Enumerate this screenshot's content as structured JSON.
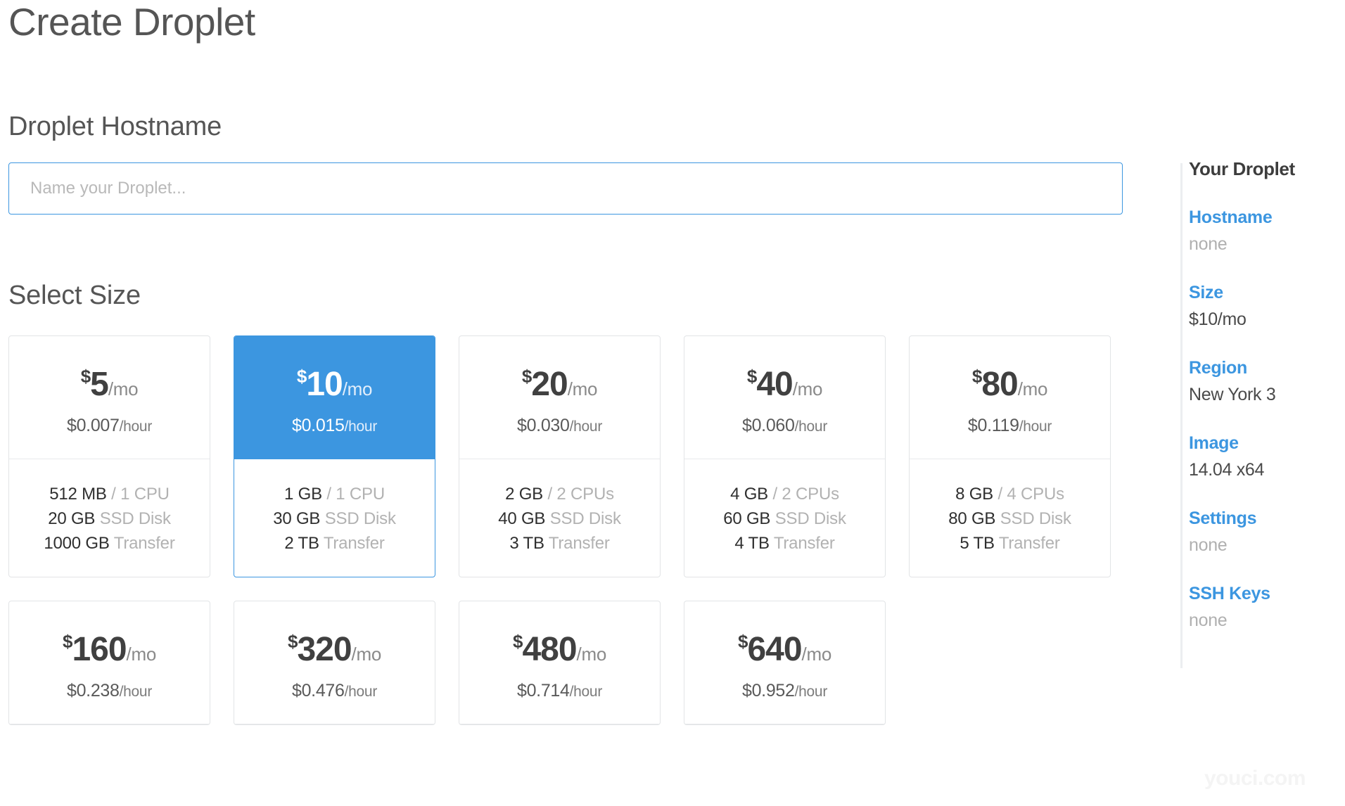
{
  "page": {
    "title": "Create Droplet",
    "watermark": "youci.com"
  },
  "hostname_section": {
    "heading": "Droplet Hostname",
    "placeholder": "Name your Droplet...",
    "value": ""
  },
  "size_section": {
    "heading": "Select Size",
    "cards": [
      {
        "currency": "$",
        "amount": "5",
        "period": "/mo",
        "hourly_price": "$0.007",
        "hourly_unit": "/hour",
        "memory": "512 MB",
        "cpu": "/ 1 CPU",
        "disk": "20 GB",
        "disk_label": "SSD Disk",
        "transfer": "1000 GB",
        "transfer_label": "Transfer",
        "selected": false,
        "specs_visible": true
      },
      {
        "currency": "$",
        "amount": "10",
        "period": "/mo",
        "hourly_price": "$0.015",
        "hourly_unit": "/hour",
        "memory": "1 GB",
        "cpu": "/ 1 CPU",
        "disk": "30 GB",
        "disk_label": "SSD Disk",
        "transfer": "2 TB",
        "transfer_label": "Transfer",
        "selected": true,
        "specs_visible": true
      },
      {
        "currency": "$",
        "amount": "20",
        "period": "/mo",
        "hourly_price": "$0.030",
        "hourly_unit": "/hour",
        "memory": "2 GB",
        "cpu": "/ 2 CPUs",
        "disk": "40 GB",
        "disk_label": "SSD Disk",
        "transfer": "3 TB",
        "transfer_label": "Transfer",
        "selected": false,
        "specs_visible": true
      },
      {
        "currency": "$",
        "amount": "40",
        "period": "/mo",
        "hourly_price": "$0.060",
        "hourly_unit": "/hour",
        "memory": "4 GB",
        "cpu": "/ 2 CPUs",
        "disk": "60 GB",
        "disk_label": "SSD Disk",
        "transfer": "4 TB",
        "transfer_label": "Transfer",
        "selected": false,
        "specs_visible": true
      },
      {
        "currency": "$",
        "amount": "80",
        "period": "/mo",
        "hourly_price": "$0.119",
        "hourly_unit": "/hour",
        "memory": "8 GB",
        "cpu": "/ 4 CPUs",
        "disk": "80 GB",
        "disk_label": "SSD Disk",
        "transfer": "5 TB",
        "transfer_label": "Transfer",
        "selected": false,
        "specs_visible": true
      },
      {
        "currency": "$",
        "amount": "160",
        "period": "/mo",
        "hourly_price": "$0.238",
        "hourly_unit": "/hour",
        "selected": false,
        "specs_visible": false
      },
      {
        "currency": "$",
        "amount": "320",
        "period": "/mo",
        "hourly_price": "$0.476",
        "hourly_unit": "/hour",
        "selected": false,
        "specs_visible": false
      },
      {
        "currency": "$",
        "amount": "480",
        "period": "/mo",
        "hourly_price": "$0.714",
        "hourly_unit": "/hour",
        "selected": false,
        "specs_visible": false
      },
      {
        "currency": "$",
        "amount": "640",
        "period": "/mo",
        "hourly_price": "$0.952",
        "hourly_unit": "/hour",
        "selected": false,
        "specs_visible": false
      }
    ]
  },
  "sidebar": {
    "title": "Your Droplet",
    "items": [
      {
        "label": "Hostname",
        "value": "none",
        "unset": true
      },
      {
        "label": "Size",
        "value": "$10/mo",
        "unset": false
      },
      {
        "label": "Region",
        "value": "New York 3",
        "unset": false
      },
      {
        "label": "Image",
        "value": "14.04 x64",
        "unset": false
      },
      {
        "label": "Settings",
        "value": "none",
        "unset": true
      },
      {
        "label": "SSH Keys",
        "value": "none",
        "unset": true
      }
    ]
  },
  "colors": {
    "accent_blue": "#3c96e0",
    "heading_gray": "#555555",
    "muted_gray": "#b2b2b2"
  }
}
